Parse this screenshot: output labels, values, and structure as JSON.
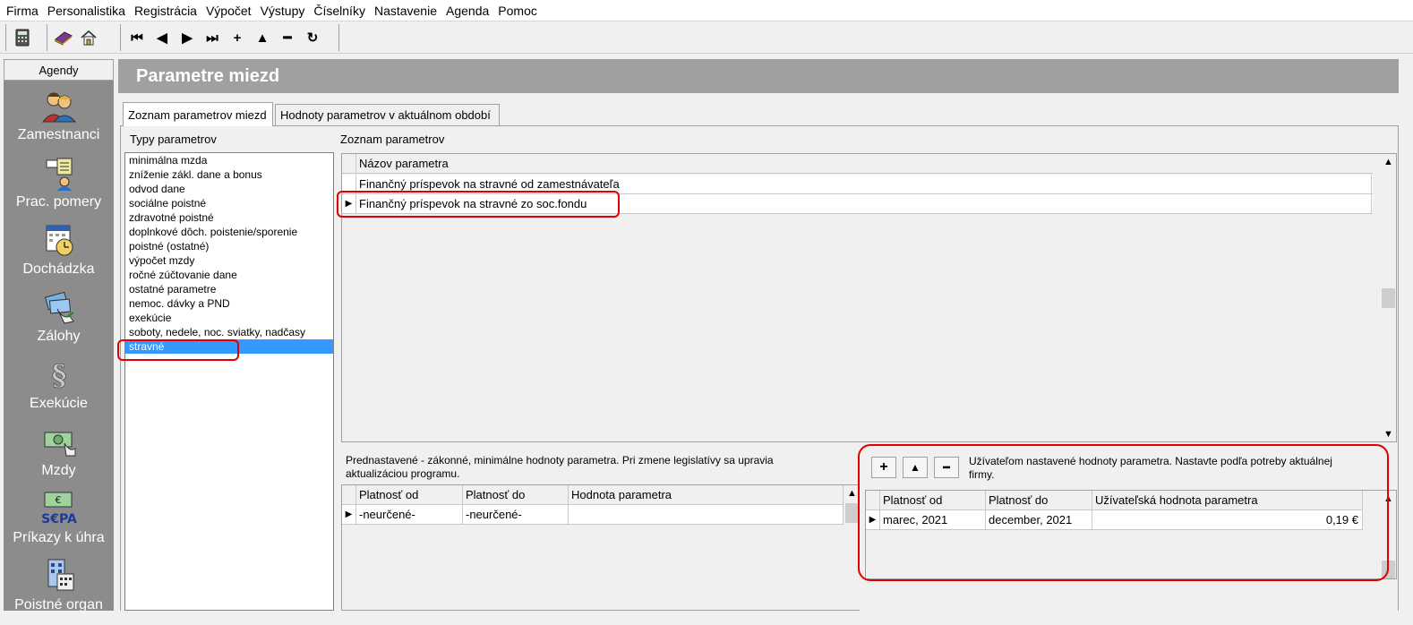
{
  "menu": [
    "Firma",
    "Personalistika",
    "Registrácia",
    "Výpočet",
    "Výstupy",
    "Číselníky",
    "Nastavenie",
    "Agenda",
    "Pomoc"
  ],
  "toolbar": {
    "buttons": [
      "calculator-icon",
      "book-icon",
      "home-icon",
      "first-record-icon",
      "previous-record-icon",
      "next-record-icon",
      "last-record-icon",
      "add-record-icon",
      "move-up-icon",
      "remove-record-icon",
      "refresh-icon"
    ],
    "glyphs": {
      "first": "⏮",
      "prev": "◀",
      "next": "▶",
      "last": "⏭",
      "add": "+",
      "up": "▲",
      "remove": "━",
      "refresh": "↻"
    }
  },
  "sidebar": {
    "header": "Agendy",
    "items": [
      {
        "label": "Zamestnanci",
        "icon": "employees-icon"
      },
      {
        "label": "Prac. pomery",
        "icon": "contracts-icon"
      },
      {
        "label": "Dochádzka",
        "icon": "attendance-icon"
      },
      {
        "label": "Zálohy",
        "icon": "advances-icon"
      },
      {
        "label": "Exekúcie",
        "icon": "paragraph-icon"
      },
      {
        "label": "Mzdy",
        "icon": "salary-icon"
      },
      {
        "label": "Príkazy k úhra",
        "icon": "sepa-icon"
      },
      {
        "label": "Poistné organ",
        "icon": "insurance-icon"
      }
    ]
  },
  "page_title": "Parametre miezd",
  "tabs": [
    "Zoznam parametrov miezd",
    "Hodnoty parametrov v aktuálnom období"
  ],
  "types": {
    "caption": "Typy parametrov",
    "items": [
      "minimálna mzda",
      "zníženie zákl. dane a bonus",
      "odvod dane",
      "sociálne poistné",
      "zdravotné poistné",
      "doplnkové dôch. poistenie/sporenie",
      "poistné (ostatné)",
      "výpočet mzdy",
      "ročné zúčtovanie dane",
      "ostatné parametre",
      "nemoc. dávky a PND",
      "exekúcie",
      "soboty, nedele, noc. sviatky, nadčasy",
      "stravné"
    ],
    "selected_index": 13
  },
  "params": {
    "caption": "Zoznam parametrov",
    "column": "Názov parametra",
    "rows": [
      "Finančný príspevok na stravné od zamestnávateľa",
      "Finančný príspevok na stravné zo soc.fondu"
    ],
    "current_index": 1
  },
  "defaults": {
    "description": "Prednastavené - zákonné, minimálne hodnoty parametra. Pri zmene legislatívy sa upravia aktualizáciou programu.",
    "columns": [
      "Platnosť od",
      "Platnosť do",
      "Hodnota parametra"
    ],
    "rows": [
      [
        "-neurčené-",
        "-neurčené-",
        ""
      ]
    ]
  },
  "user_values": {
    "description": "Užívateľom nastavené hodnoty parametra. Nastavte podľa potreby aktuálnej firmy.",
    "buttons": {
      "add": "+",
      "up": "▲",
      "remove": "━"
    },
    "columns": [
      "Platnosť od",
      "Platnosť do",
      "Užívateľská hodnota parametra"
    ],
    "rows": [
      [
        "marec, 2021",
        "december, 2021",
        "0,19 €"
      ]
    ]
  },
  "colors": {
    "selection": "#3399ff",
    "highlight_box": "#e00000",
    "sidebar": "#8c8c8c",
    "title_bar": "#a0a0a0"
  }
}
